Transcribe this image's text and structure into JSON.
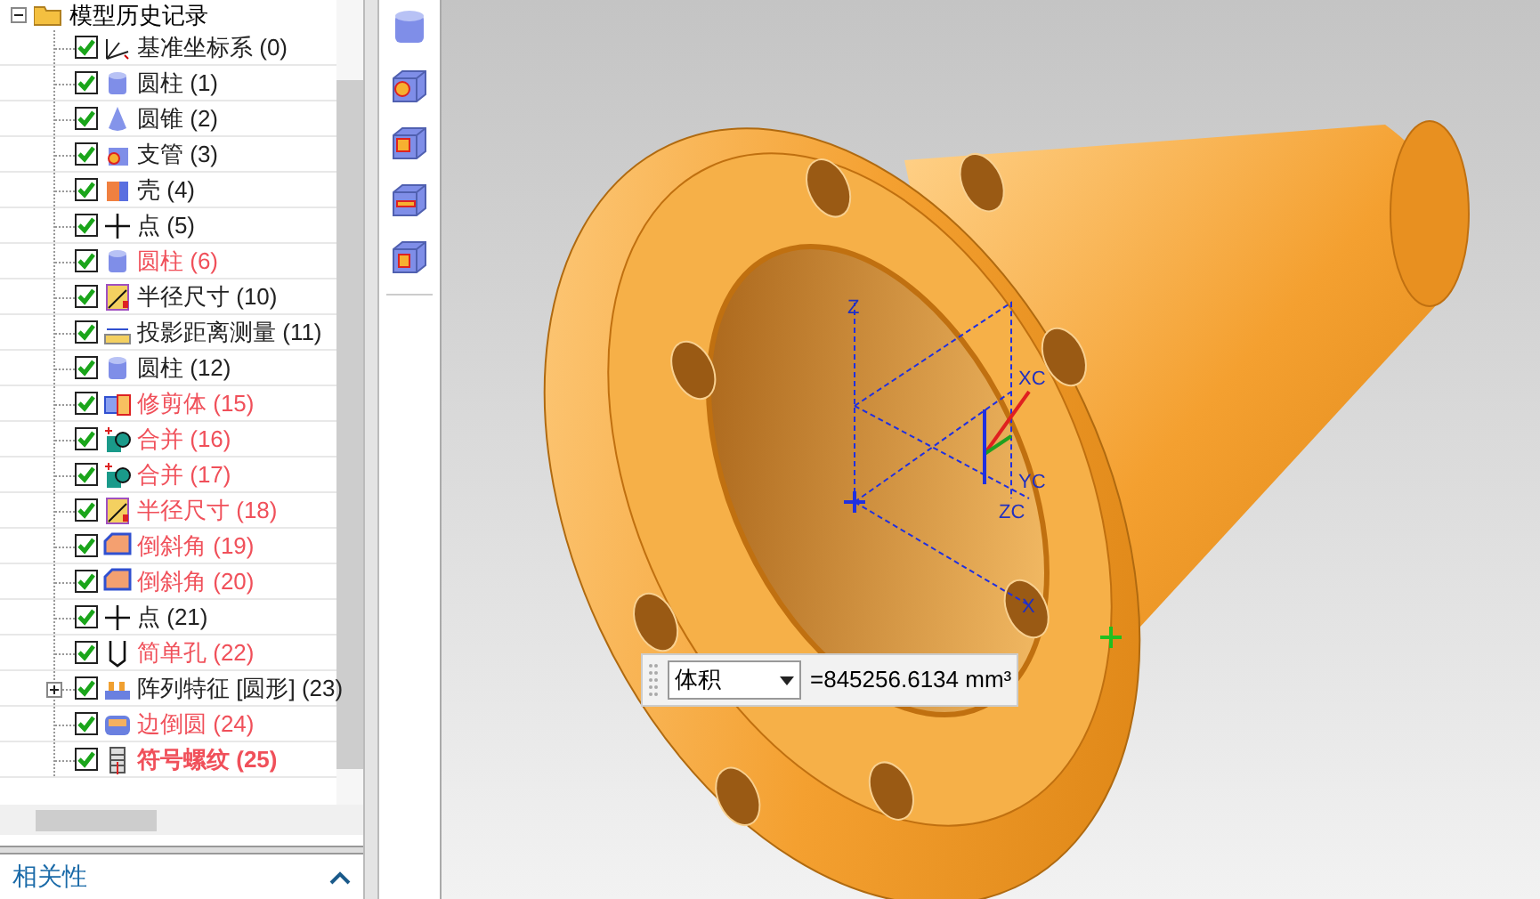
{
  "tree": {
    "root": {
      "label": "模型历史记录",
      "expanded": true
    },
    "items": [
      {
        "label": "基准坐标系 (0)",
        "kind": "datum",
        "color": "#222222",
        "bold": false,
        "collapsed": false
      },
      {
        "label": "圆柱 (1)",
        "kind": "cylinder",
        "color": "#222222",
        "bold": false,
        "collapsed": false
      },
      {
        "label": "圆锥 (2)",
        "kind": "cone",
        "color": "#222222",
        "bold": false,
        "collapsed": false
      },
      {
        "label": "支管 (3)",
        "kind": "boss",
        "color": "#222222",
        "bold": false,
        "collapsed": false
      },
      {
        "label": "壳 (4)",
        "kind": "shell",
        "color": "#222222",
        "bold": false,
        "collapsed": false
      },
      {
        "label": "点 (5)",
        "kind": "point",
        "color": "#222222",
        "bold": false,
        "collapsed": false
      },
      {
        "label": "圆柱 (6)",
        "kind": "cylinder",
        "color": "#f0505a",
        "bold": false,
        "collapsed": false
      },
      {
        "label": "半径尺寸 (10)",
        "kind": "dimension",
        "color": "#222222",
        "bold": false,
        "collapsed": false
      },
      {
        "label": "投影距离测量 (11)",
        "kind": "measure",
        "color": "#222222",
        "bold": false,
        "collapsed": false
      },
      {
        "label": "圆柱 (12)",
        "kind": "cylinder",
        "color": "#222222",
        "bold": false,
        "collapsed": false
      },
      {
        "label": "修剪体 (15)",
        "kind": "trim",
        "color": "#f0505a",
        "bold": false,
        "collapsed": false
      },
      {
        "label": "合并 (16)",
        "kind": "unite",
        "color": "#f0505a",
        "bold": false,
        "collapsed": false
      },
      {
        "label": "合并 (17)",
        "kind": "unite",
        "color": "#f0505a",
        "bold": false,
        "collapsed": false
      },
      {
        "label": "半径尺寸 (18)",
        "kind": "dimension",
        "color": "#f0505a",
        "bold": false,
        "collapsed": false
      },
      {
        "label": "倒斜角 (19)",
        "kind": "chamfer",
        "color": "#f0505a",
        "bold": false,
        "collapsed": false
      },
      {
        "label": "倒斜角 (20)",
        "kind": "chamfer",
        "color": "#f0505a",
        "bold": false,
        "collapsed": false
      },
      {
        "label": "点 (21)",
        "kind": "point",
        "color": "#222222",
        "bold": false,
        "collapsed": false
      },
      {
        "label": "简单孔 (22)",
        "kind": "hole",
        "color": "#f0505a",
        "bold": false,
        "collapsed": false
      },
      {
        "label": "阵列特征 [圆形] (23)",
        "kind": "pattern",
        "color": "#222222",
        "bold": false,
        "collapsed": true
      },
      {
        "label": "边倒圆 (24)",
        "kind": "blend",
        "color": "#f0505a",
        "bold": false,
        "collapsed": false
      },
      {
        "label": "符号螺纹 (25)",
        "kind": "thread",
        "color": "#f0505a",
        "bold": true,
        "collapsed": false
      }
    ]
  },
  "panel": {
    "title": "相关性"
  },
  "axes": {
    "labels": [
      "Z",
      "XC",
      "YC",
      "ZC",
      "X"
    ]
  },
  "measure": {
    "dropdown": "体积",
    "value": "=845256.6134 mm³"
  }
}
